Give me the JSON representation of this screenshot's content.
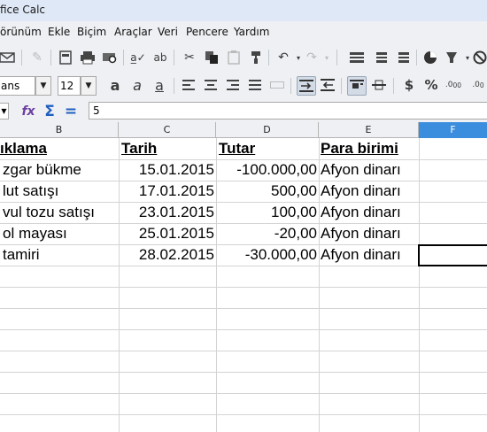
{
  "window": {
    "title": "fice Calc"
  },
  "menu": {
    "items": [
      {
        "label": "örünüm"
      },
      {
        "label": "Ekle"
      },
      {
        "label": "Biçim"
      },
      {
        "label": "Araçlar"
      },
      {
        "label": "Veri"
      },
      {
        "label": "Pencere"
      },
      {
        "label": "Yardım"
      }
    ]
  },
  "toolbar": {
    "icons": [
      "mail-icon",
      "edit-file-icon",
      "export-pdf-icon",
      "print-icon",
      "print-preview-icon",
      "spellcheck-icon",
      "autospell-icon",
      "cut-icon",
      "copy-icon",
      "paste-icon",
      "clone-format-icon",
      "undo-icon",
      "redo-icon",
      "find-replace-icon",
      "sort-ascending-icon",
      "sort-descending-icon",
      "autofilter-icon",
      "chart-icon",
      "pivot-icon",
      "navigator-icon"
    ]
  },
  "format_bar": {
    "font_name": "ans",
    "font_size": "12",
    "icons": [
      "bold-icon",
      "italic-icon",
      "underline-icon",
      "align-left-icon",
      "align-center-icon",
      "align-right-icon",
      "justify-icon",
      "merge-cells-icon",
      "wrap-text-icon",
      "rtl-icon",
      "align-top-icon",
      "align-middle-icon",
      "currency-icon",
      "percent-icon",
      "decimal-add-icon",
      "decimal-remove-icon"
    ]
  },
  "formula_bar": {
    "function_wizard": "fx",
    "sum": "Σ",
    "equals": "=",
    "content": "5"
  },
  "columns": [
    "B",
    "C",
    "D",
    "E",
    "F"
  ],
  "selected_column": "F",
  "sheet": {
    "header": {
      "b": "ıklama ",
      "c": "Tarih",
      "d": "Tutar",
      "e": "Para birimi"
    },
    "rows": [
      {
        "b": "zgar bükme",
        "c": "15.01.2015",
        "d": "-100.000,00",
        "e": "Afyon dinarı"
      },
      {
        "b": "lut satışı",
        "c": "17.01.2015",
        "d": "500,00",
        "e": "Afyon dinarı"
      },
      {
        "b": "vul tozu satışı",
        "c": "23.01.2015",
        "d": "100,00",
        "e": "Afyon dinarı"
      },
      {
        "b": "ol mayası",
        "c": "25.01.2015",
        "d": "-20,00",
        "e": "Afyon dinarı"
      },
      {
        "b": " tamiri",
        "c": "28.02.2015",
        "d": "-30.000,00",
        "e": "Afyon dinarı"
      }
    ]
  },
  "colors": {
    "selected_column_header": "#3b8ddd",
    "toolbar_bg": "#eef0f3"
  }
}
